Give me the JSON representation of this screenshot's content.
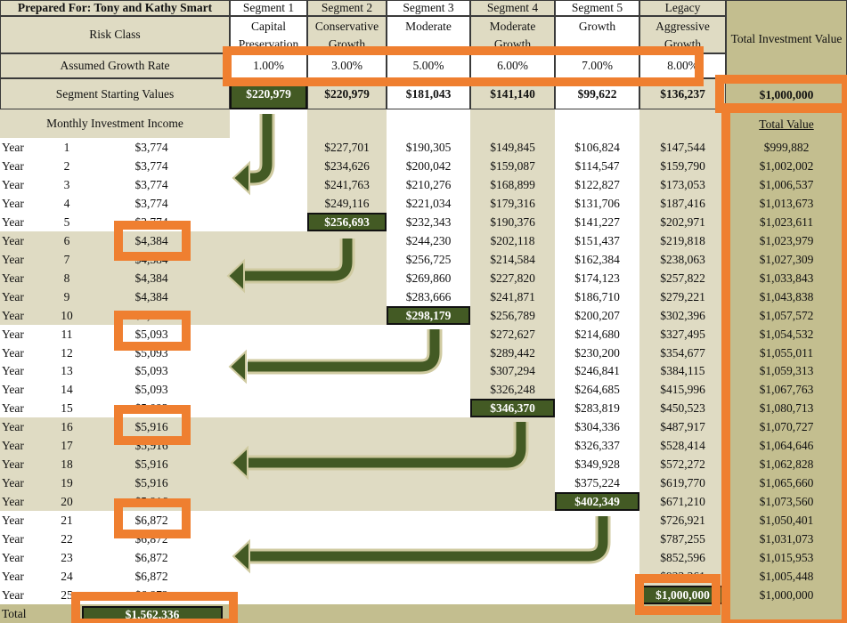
{
  "header": {
    "prepared_for": "Prepared For: Tony and Kathy Smart",
    "risk_class_label": "Risk Class",
    "growth_rate_label": "Assumed Growth Rate",
    "starting_values_label": "Segment Starting Values",
    "monthly_income_label": "Monthly Investment Income",
    "total_investment_value_label": "Total Investment Value",
    "total_value_label": "Total Value",
    "total_starting_value": "$1,000,000"
  },
  "segments": [
    {
      "name": "Segment 1",
      "risk_class": "Capital Preservation",
      "growth_rate": "1.00%",
      "starting_value": "$220,979",
      "values": []
    },
    {
      "name": "Segment 2",
      "risk_class": "Conservative Growth",
      "growth_rate": "3.00%",
      "starting_value": "$220,979",
      "values": [
        "$227,701",
        "$234,626",
        "$241,763",
        "$249,116",
        "$256,693"
      ]
    },
    {
      "name": "Segment 3",
      "risk_class": "Moderate",
      "growth_rate": "5.00%",
      "starting_value": "$181,043",
      "values": [
        "$190,305",
        "$200,042",
        "$210,276",
        "$221,034",
        "$232,343",
        "$244,230",
        "$256,725",
        "$269,860",
        "$283,666",
        "$298,179"
      ]
    },
    {
      "name": "Segment 4",
      "risk_class": "Moderate Growth",
      "growth_rate": "6.00%",
      "starting_value": "$141,140",
      "values": [
        "$149,845",
        "$159,087",
        "$168,899",
        "$179,316",
        "$190,376",
        "$202,118",
        "$214,584",
        "$227,820",
        "$241,871",
        "$256,789",
        "$272,627",
        "$289,442",
        "$307,294",
        "$326,248",
        "$346,370"
      ]
    },
    {
      "name": "Segment 5",
      "risk_class": "Growth",
      "growth_rate": "7.00%",
      "starting_value": "$99,622",
      "values": [
        "$106,824",
        "$114,547",
        "$122,827",
        "$131,706",
        "$141,227",
        "$151,437",
        "$162,384",
        "$174,123",
        "$186,710",
        "$200,207",
        "$214,680",
        "$230,200",
        "$246,841",
        "$264,685",
        "$283,819",
        "$304,336",
        "$326,337",
        "$349,928",
        "$375,224",
        "$402,349"
      ]
    },
    {
      "name": "Legacy",
      "risk_class": "Aggressive Growth",
      "growth_rate": "8.00%",
      "starting_value": "$136,237",
      "values": [
        "$147,544",
        "$159,790",
        "$173,053",
        "$187,416",
        "$202,971",
        "$219,818",
        "$238,063",
        "$257,822",
        "$279,221",
        "$302,396",
        "$327,495",
        "$354,677",
        "$384,115",
        "$415,996",
        "$450,523",
        "$487,917",
        "$528,414",
        "$572,272",
        "$619,770",
        "$671,210",
        "$726,921",
        "$787,255",
        "$852,596",
        "$923,361",
        "$1,000,000"
      ]
    }
  ],
  "year_label": "Year",
  "years": [
    {
      "number": "1",
      "income": "$3,774",
      "total": "$999,882"
    },
    {
      "number": "2",
      "income": "$3,774",
      "total": "$1,002,002"
    },
    {
      "number": "3",
      "income": "$3,774",
      "total": "$1,006,537"
    },
    {
      "number": "4",
      "income": "$3,774",
      "total": "$1,013,673"
    },
    {
      "number": "5",
      "income": "$3,774",
      "total": "$1,023,611"
    },
    {
      "number": "6",
      "income": "$4,384",
      "total": "$1,023,979"
    },
    {
      "number": "7",
      "income": "$4,384",
      "total": "$1,027,309"
    },
    {
      "number": "8",
      "income": "$4,384",
      "total": "$1,033,843"
    },
    {
      "number": "9",
      "income": "$4,384",
      "total": "$1,043,838"
    },
    {
      "number": "10",
      "income": "$4,384",
      "total": "$1,057,572"
    },
    {
      "number": "11",
      "income": "$5,093",
      "total": "$1,054,532"
    },
    {
      "number": "12",
      "income": "$5,093",
      "total": "$1,055,011"
    },
    {
      "number": "13",
      "income": "$5,093",
      "total": "$1,059,313"
    },
    {
      "number": "14",
      "income": "$5,093",
      "total": "$1,067,763"
    },
    {
      "number": "15",
      "income": "$5,093",
      "total": "$1,080,713"
    },
    {
      "number": "16",
      "income": "$5,916",
      "total": "$1,070,727"
    },
    {
      "number": "17",
      "income": "$5,916",
      "total": "$1,064,646"
    },
    {
      "number": "18",
      "income": "$5,916",
      "total": "$1,062,828"
    },
    {
      "number": "19",
      "income": "$5,916",
      "total": "$1,065,660"
    },
    {
      "number": "20",
      "income": "$5,916",
      "total": "$1,073,560"
    },
    {
      "number": "21",
      "income": "$6,872",
      "total": "$1,050,401"
    },
    {
      "number": "22",
      "income": "$6,872",
      "total": "$1,031,073"
    },
    {
      "number": "23",
      "income": "$6,872",
      "total": "$1,015,953"
    },
    {
      "number": "24",
      "income": "$6,872",
      "total": "$1,005,448"
    },
    {
      "number": "25",
      "income": "$6,872",
      "total": "$1,000,000"
    }
  ],
  "total_row": {
    "label": "Total",
    "income": "$1,562,336"
  },
  "colors": {
    "beige": "#dfdbc3",
    "olive": "#c3be8f",
    "highlight_green": "#435a24",
    "annotation_orange": "#ef7f30"
  },
  "icons": {
    "arrows": "curved-arrow-left"
  }
}
